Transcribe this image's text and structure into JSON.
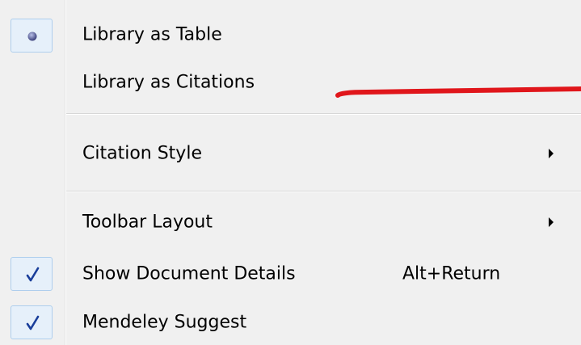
{
  "menu": {
    "items": [
      {
        "label": "Library as Table",
        "indicator": "radio-dot-icon",
        "selected": true
      },
      {
        "label": "Library as Citations",
        "indicator": "none",
        "selected": false
      },
      {
        "label": "Citation Style",
        "indicator": "none",
        "submenu": true
      },
      {
        "label": "Toolbar Layout",
        "indicator": "none",
        "submenu": true
      },
      {
        "label": "Show Document Details",
        "shortcut": "Alt+Return",
        "indicator": "checkmark-icon",
        "checked": true
      },
      {
        "label": "Mendeley Suggest",
        "indicator": "checkmark-icon",
        "checked": true
      }
    ]
  },
  "colors": {
    "menu_background": "#f0f0f0",
    "check_highlight_fill": "#e6f0fa",
    "check_highlight_border": "#aeceed",
    "checkmark": "#1a3e9a",
    "annotation_line": "#e0161b"
  }
}
